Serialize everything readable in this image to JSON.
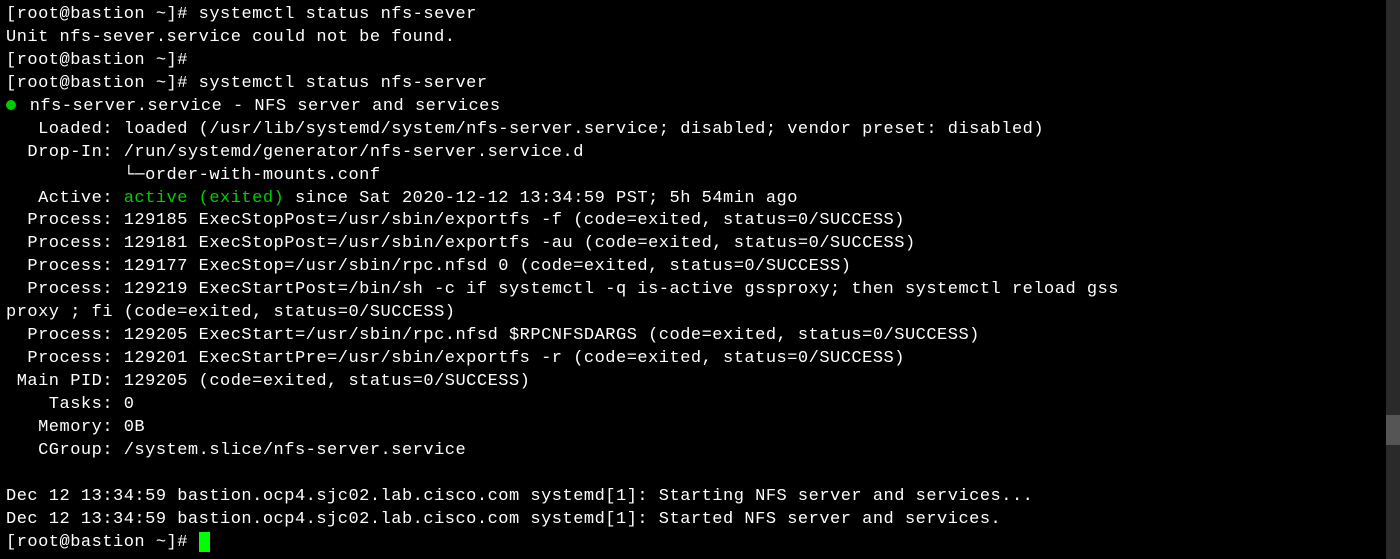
{
  "prompt": "[root@bastion ~]# ",
  "cmd1": "systemctl status nfs-sever",
  "err1": "Unit nfs-sever.service could not be found.",
  "cmd2": "systemctl status nfs-server",
  "service_bullet_line": " nfs-server.service - NFS server and services",
  "loaded_line": "   Loaded: loaded (/usr/lib/systemd/system/nfs-server.service; disabled; vendor preset: disabled)",
  "dropin_line": "  Drop-In: /run/systemd/generator/nfs-server.service.d",
  "dropin_sub": "           └─order-with-mounts.conf",
  "active_label": "   Active: ",
  "active_value": "active (exited)",
  "active_since": " since Sat 2020-12-12 13:34:59 PST; 5h 54min ago",
  "proc1": "  Process: 129185 ExecStopPost=/usr/sbin/exportfs -f (code=exited, status=0/SUCCESS)",
  "proc2": "  Process: 129181 ExecStopPost=/usr/sbin/exportfs -au (code=exited, status=0/SUCCESS)",
  "proc3": "  Process: 129177 ExecStop=/usr/sbin/rpc.nfsd 0 (code=exited, status=0/SUCCESS)",
  "proc4": "  Process: 129219 ExecStartPost=/bin/sh -c if systemctl -q is-active gssproxy; then systemctl reload gss",
  "proc4b": "proxy ; fi (code=exited, status=0/SUCCESS)",
  "proc5": "  Process: 129205 ExecStart=/usr/sbin/rpc.nfsd $RPCNFSDARGS (code=exited, status=0/SUCCESS)",
  "proc6": "  Process: 129201 ExecStartPre=/usr/sbin/exportfs -r (code=exited, status=0/SUCCESS)",
  "mainpid": " Main PID: 129205 (code=exited, status=0/SUCCESS)",
  "tasks": "    Tasks: 0",
  "memory": "   Memory: 0B",
  "cgroup": "   CGroup: /system.slice/nfs-server.service",
  "log1": "Dec 12 13:34:59 bastion.ocp4.sjc02.lab.cisco.com systemd[1]: Starting NFS server and services...",
  "log2": "Dec 12 13:34:59 bastion.ocp4.sjc02.lab.cisco.com systemd[1]: Started NFS server and services."
}
